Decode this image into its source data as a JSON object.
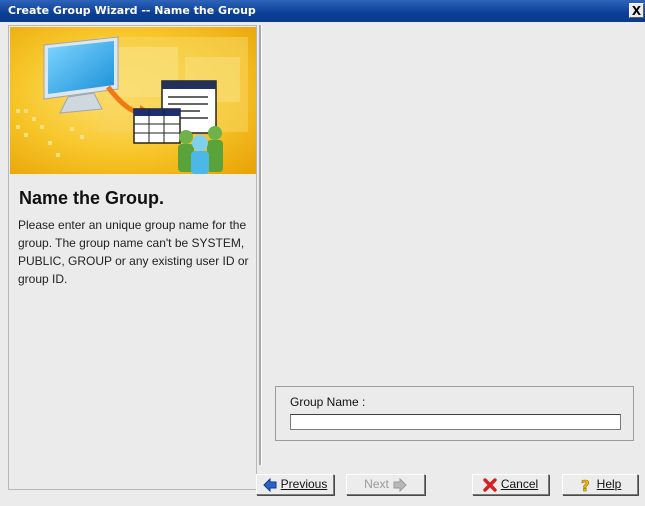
{
  "window": {
    "title": "Create Group Wizard -- Name the Group",
    "close_label": "X"
  },
  "left_panel": {
    "heading": "Name the Group.",
    "description": " Please enter an unique group name for the group. The group name can't be SYSTEM, PUBLIC, GROUP or any existing user ID or group ID."
  },
  "form": {
    "group_name_label": "Group Name :",
    "group_name_value": ""
  },
  "buttons": {
    "previous": "Previous",
    "next": "Next",
    "cancel": "Cancel",
    "help": "Help"
  },
  "colors": {
    "titlebar": "#0a3f95",
    "banner_yellow": "#f5c01c",
    "arrow_blue": "#2a64c8",
    "cancel_red": "#d42020",
    "help_yellow": "#f2c200"
  }
}
